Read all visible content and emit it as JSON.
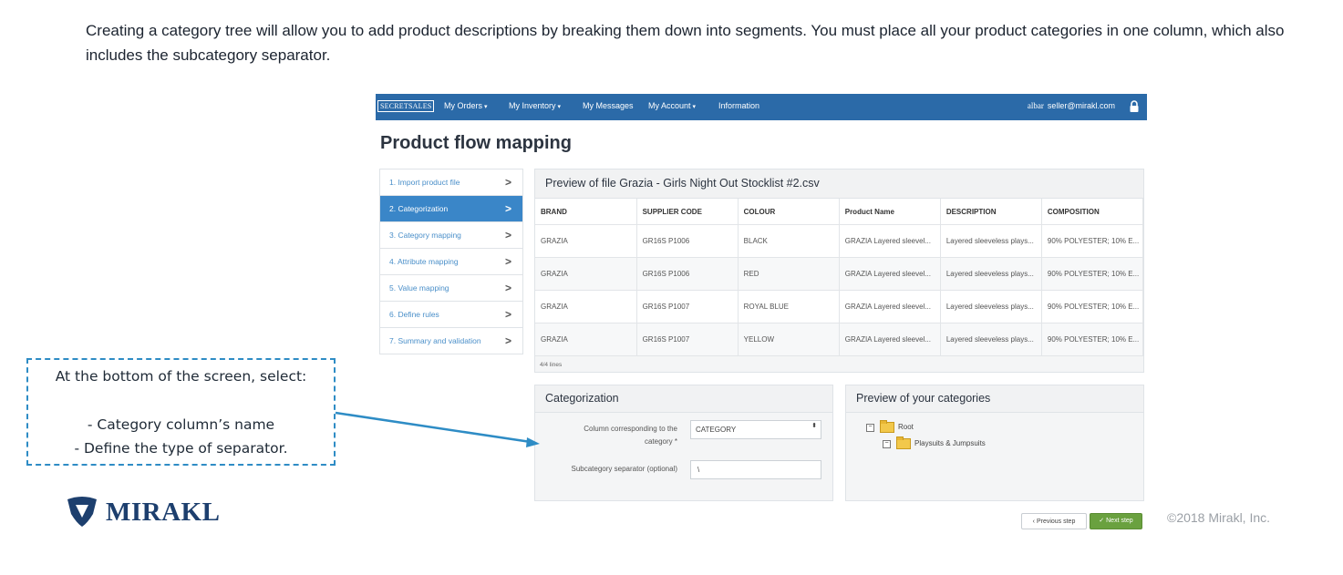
{
  "intro_text": "Creating a category tree will allow you to add product descriptions by breaking them down into segments. You must place all your product categories in one column, which also includes the subcategory separator.",
  "app": {
    "logo_text": "SECRETSALES",
    "nav": [
      {
        "label": "My Orders",
        "has_caret": true
      },
      {
        "label": "My Inventory",
        "has_caret": true
      },
      {
        "label": "My Messages",
        "has_caret": false
      },
      {
        "label": "My Account",
        "has_caret": true
      },
      {
        "label": "Information",
        "has_caret": false
      }
    ],
    "nav_caret": "▾",
    "user_name": "albar",
    "user_email": "seller@mirakl.com",
    "page_title": "Product flow mapping",
    "steps": [
      {
        "label": "1. Import product file",
        "active": false
      },
      {
        "label": "2. Categorization",
        "active": true
      },
      {
        "label": "3. Category mapping",
        "active": false
      },
      {
        "label": "4. Attribute mapping",
        "active": false
      },
      {
        "label": "5. Value mapping",
        "active": false
      },
      {
        "label": "6. Define rules",
        "active": false
      },
      {
        "label": "7. Summary and validation",
        "active": false
      }
    ],
    "step_chevron": ">",
    "preview": {
      "title": "Preview of file Grazia - Girls Night Out Stocklist #2.csv",
      "columns": [
        "BRAND",
        "SUPPLIER CODE",
        "COLOUR",
        "Product Name",
        "DESCRIPTION",
        "COMPOSITION"
      ],
      "rows": [
        [
          "GRAZIA",
          "GR16S P1006",
          "BLACK",
          "GRAZIA Layered sleevel...",
          "Layered sleeveless plays...",
          "90% POLYESTER; 10% E..."
        ],
        [
          "GRAZIA",
          "GR16S P1006",
          "RED",
          "GRAZIA Layered sleevel...",
          "Layered sleeveless plays...",
          "90% POLYESTER; 10% E..."
        ],
        [
          "GRAZIA",
          "GR16S P1007",
          "ROYAL BLUE",
          "GRAZIA Layered sleevel...",
          "Layered sleeveless plays...",
          "90% POLYESTER; 10% E..."
        ],
        [
          "GRAZIA",
          "GR16S P1007",
          "YELLOW",
          "GRAZIA Layered sleevel...",
          "Layered sleeveless plays...",
          "90% POLYESTER; 10% E..."
        ]
      ],
      "lines_count": "4/4 lines"
    },
    "categorization": {
      "title": "Categorization",
      "column_label_line1": "Column corresponding to the",
      "column_label_line2": "category *",
      "column_value": "CATEGORY",
      "select_arrows": "⬍",
      "separator_label": "Subcategory separator (optional)",
      "separator_value": "\\"
    },
    "categories_preview": {
      "title": "Preview of your categories",
      "tree": [
        {
          "label": "Root",
          "level": 0
        },
        {
          "label": "Playsuits & Jumpsuits",
          "level": 1
        }
      ],
      "toggle_symbol": "⊟"
    },
    "buttons": {
      "prev_icon": "‹",
      "prev_label": "Previous step",
      "next_icon": "✓",
      "next_label": "Next step"
    }
  },
  "callout": {
    "line1": "At the bottom of the screen, select:",
    "line2": "- Category column’s name",
    "line3": "- Define the type of separator."
  },
  "brand": {
    "name": "MIRAKL",
    "copyright": "©2018 Mirakl, Inc."
  },
  "colors": {
    "nav_bg": "#2b6aa8",
    "active_step": "#3a86c8",
    "next_button": "#6aa13f",
    "callout_border": "#2e8cc5",
    "brand_navy": "#1d3f6e"
  }
}
